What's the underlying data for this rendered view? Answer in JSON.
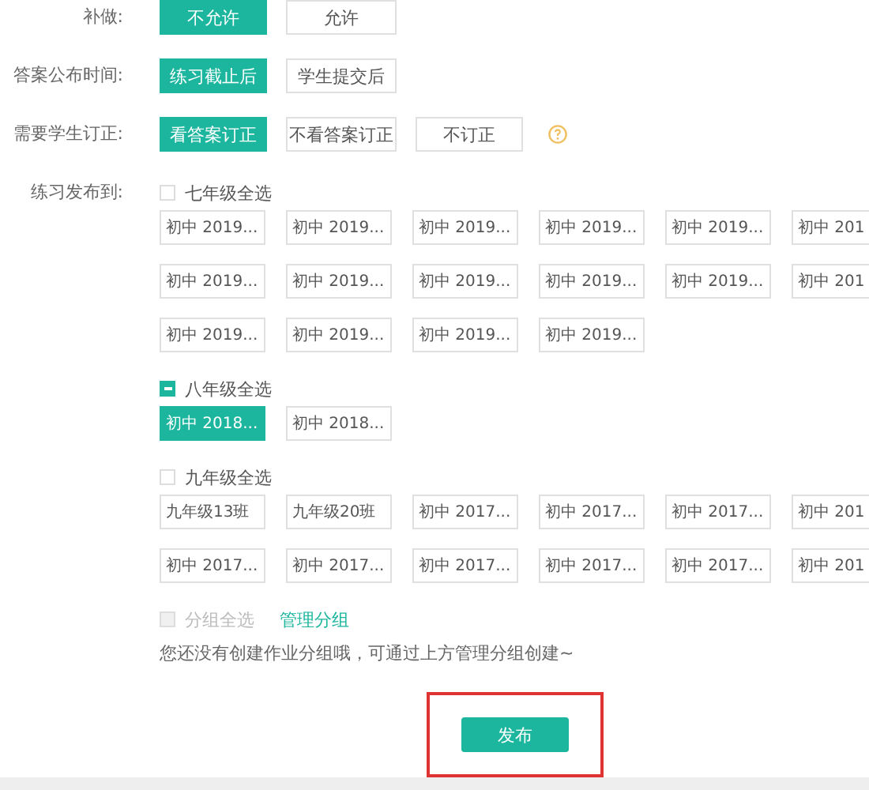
{
  "settings": [
    {
      "label": "补做:",
      "options": [
        {
          "label": "不允许",
          "selected": true
        },
        {
          "label": "允许",
          "selected": false
        }
      ]
    },
    {
      "label": "答案公布时间:",
      "options": [
        {
          "label": "练习截止后",
          "selected": true
        },
        {
          "label": "学生提交后",
          "selected": false
        }
      ]
    },
    {
      "label": "需要学生订正:",
      "options": [
        {
          "label": "看答案订正",
          "selected": true
        },
        {
          "label": "不看答案订正",
          "selected": false
        },
        {
          "label": "不订正",
          "selected": false
        }
      ],
      "help": true
    }
  ],
  "publish": {
    "label": "练习发布到:",
    "grades": [
      {
        "name": "七年级全选",
        "partial": false,
        "classes": [
          {
            "label": "初中 2019...",
            "selected": false
          },
          {
            "label": "初中 2019...",
            "selected": false
          },
          {
            "label": "初中 2019...",
            "selected": false
          },
          {
            "label": "初中 2019...",
            "selected": false
          },
          {
            "label": "初中 2019...",
            "selected": false
          },
          {
            "label": "初中 201",
            "selected": false
          },
          {
            "label": "初中 2019...",
            "selected": false
          },
          {
            "label": "初中 2019...",
            "selected": false
          },
          {
            "label": "初中 2019...",
            "selected": false
          },
          {
            "label": "初中 2019...",
            "selected": false
          },
          {
            "label": "初中 2019...",
            "selected": false
          },
          {
            "label": "初中 201",
            "selected": false
          },
          {
            "label": "初中 2019...",
            "selected": false
          },
          {
            "label": "初中 2019...",
            "selected": false
          },
          {
            "label": "初中 2019...",
            "selected": false
          },
          {
            "label": "初中 2019...",
            "selected": false
          }
        ]
      },
      {
        "name": "八年级全选",
        "partial": true,
        "classes": [
          {
            "label": "初中 2018...",
            "selected": true
          },
          {
            "label": "初中 2018...",
            "selected": false
          }
        ]
      },
      {
        "name": "九年级全选",
        "partial": false,
        "classes": [
          {
            "label": "九年级13班",
            "selected": false
          },
          {
            "label": "九年级20班",
            "selected": false
          },
          {
            "label": "初中 2017...",
            "selected": false
          },
          {
            "label": "初中 2017...",
            "selected": false
          },
          {
            "label": "初中 2017...",
            "selected": false
          },
          {
            "label": "初中 201",
            "selected": false
          },
          {
            "label": "初中 2017...",
            "selected": false
          },
          {
            "label": "初中 2017...",
            "selected": false
          },
          {
            "label": "初中 2017...",
            "selected": false
          },
          {
            "label": "初中 2017...",
            "selected": false
          },
          {
            "label": "初中 2017...",
            "selected": false
          },
          {
            "label": "初中 201",
            "selected": false
          }
        ]
      }
    ],
    "group": {
      "label": "分组全选",
      "disabled": true,
      "manage": "管理分组",
      "hint": "您还没有创建作业分组哦，可通过上方管理分组创建~"
    }
  },
  "submit": "发布"
}
